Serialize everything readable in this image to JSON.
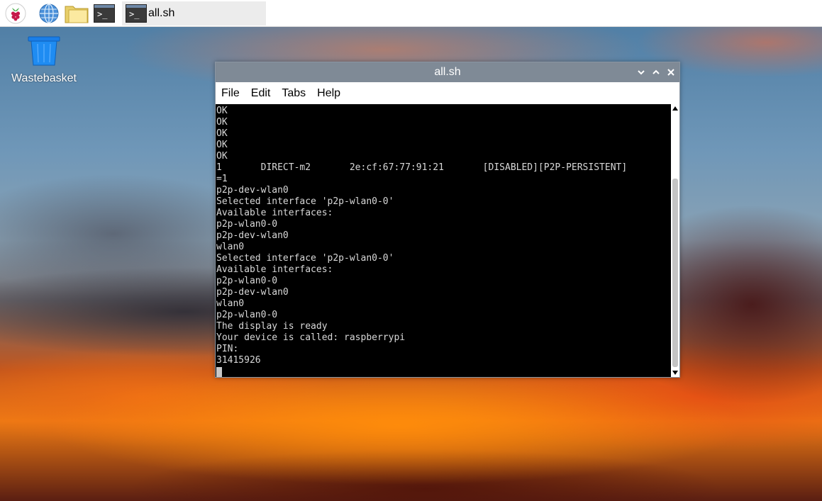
{
  "taskbar": {
    "launchers": [
      {
        "icon": "raspberry-pi-menu-icon"
      },
      {
        "icon": "web-browser-globe-icon"
      },
      {
        "icon": "file-manager-folder-icon"
      },
      {
        "icon": "terminal-icon"
      }
    ],
    "task_button": {
      "label": "all.sh",
      "icon": "terminal-icon"
    }
  },
  "desktop": {
    "icons": [
      {
        "label": "Wastebasket",
        "icon": "wastebasket-icon"
      }
    ]
  },
  "window": {
    "title": "all.sh",
    "menu": {
      "file": "File",
      "edit": "Edit",
      "tabs": "Tabs",
      "help": "Help"
    },
    "terminal_lines": [
      "OK",
      "OK",
      "OK",
      "OK",
      "OK",
      "1       DIRECT-m2       2e:cf:67:77:91:21       [DISABLED][P2P-PERSISTENT]",
      "=1",
      "p2p-dev-wlan0",
      "Selected interface 'p2p-wlan0-0'",
      "Available interfaces:",
      "p2p-wlan0-0",
      "p2p-dev-wlan0",
      "wlan0",
      "Selected interface 'p2p-wlan0-0'",
      "Available interfaces:",
      "p2p-wlan0-0",
      "p2p-dev-wlan0",
      "wlan0",
      "p2p-wlan0-0",
      "The display is ready",
      "Your device is called: raspberrypi",
      "PIN:",
      "31415926"
    ]
  },
  "colors": {
    "titlebar": "#7f8a96",
    "terminal_bg": "#000000",
    "terminal_fg": "#d8d8d8"
  }
}
